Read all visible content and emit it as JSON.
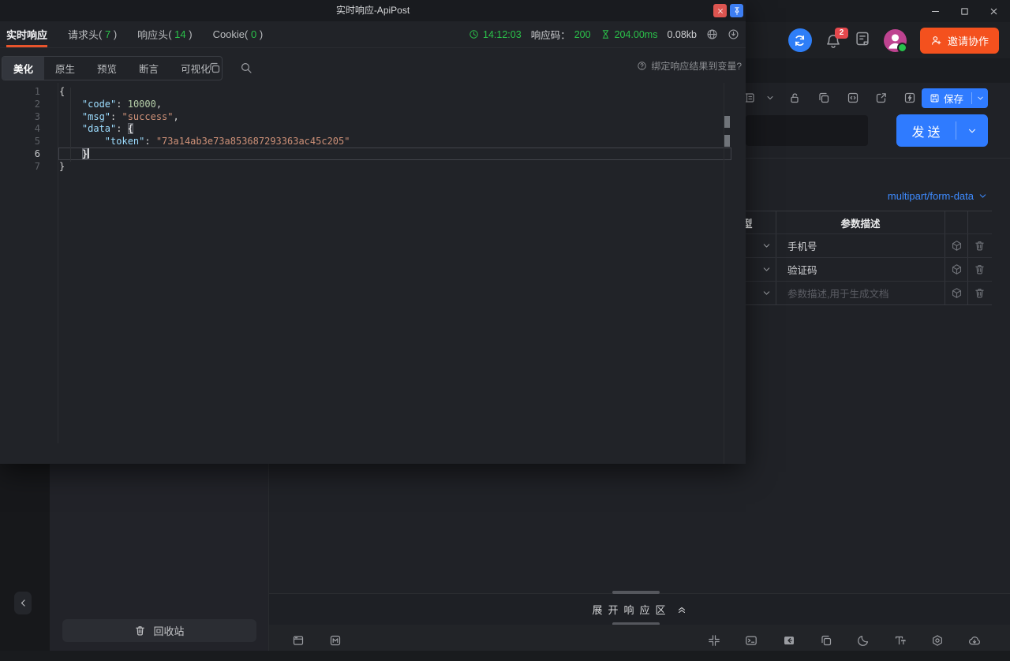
{
  "float_window": {
    "title": "实时响应-ApiPost",
    "close_icon": "xmark-icon",
    "pin_icon": "pin-icon",
    "tabs": [
      {
        "label": "实时响应",
        "count": null,
        "active": true
      },
      {
        "label": "请求头",
        "count": "7",
        "active": false
      },
      {
        "label": "响应头",
        "count": "14",
        "active": false
      },
      {
        "label": "Cookie",
        "count": "0",
        "active": false
      }
    ],
    "status": {
      "time": "14:12:03",
      "code_label": "响应码：",
      "code": "200",
      "duration": "204.00ms",
      "size": "0.08kb",
      "icons": [
        "globe-icon",
        "download-icon"
      ]
    },
    "view_tabs": [
      {
        "label": "美化",
        "active": true
      },
      {
        "label": "原生",
        "active": false
      },
      {
        "label": "预览",
        "active": false
      },
      {
        "label": "断言",
        "active": false
      },
      {
        "label": "可视化",
        "active": false
      }
    ],
    "bind_hint": "绑定响应结果到变量?",
    "editor": {
      "lines": [
        {
          "num": "1",
          "active": false,
          "tokens": [
            [
              "p",
              "{"
            ]
          ]
        },
        {
          "num": "2",
          "active": false,
          "tokens": [
            [
              "p",
              "    "
            ],
            [
              "k",
              "\"code\""
            ],
            [
              "p",
              ": "
            ],
            [
              "n",
              "10000"
            ],
            [
              "p",
              ","
            ]
          ]
        },
        {
          "num": "3",
          "active": false,
          "tokens": [
            [
              "p",
              "    "
            ],
            [
              "k",
              "\"msg\""
            ],
            [
              "p",
              ": "
            ],
            [
              "s",
              "\"success\""
            ],
            [
              "p",
              ","
            ]
          ]
        },
        {
          "num": "4",
          "active": false,
          "tokens": [
            [
              "p",
              "    "
            ],
            [
              "k",
              "\"data\""
            ],
            [
              "p",
              ": "
            ],
            [
              "bm",
              "{"
            ]
          ]
        },
        {
          "num": "5",
          "active": false,
          "tokens": [
            [
              "p",
              "        "
            ],
            [
              "k",
              "\"token\""
            ],
            [
              "p",
              ": "
            ],
            [
              "s",
              "\"73a14ab3e73a853687293363ac45c205\""
            ]
          ]
        },
        {
          "num": "6",
          "active": true,
          "tokens": [
            [
              "p",
              "    "
            ],
            [
              "bm",
              "}"
            ],
            [
              "cursor",
              ""
            ]
          ]
        },
        {
          "num": "7",
          "active": false,
          "tokens": [
            [
              "p",
              "}"
            ]
          ]
        }
      ]
    }
  },
  "app": {
    "window_controls": [
      "minimize-icon",
      "maximize-icon",
      "xmark-icon"
    ],
    "header": {
      "sync_icon": "sync-icon",
      "bell_icon": "bell-icon",
      "notification_count": "2",
      "note_icon": "note-icon",
      "avatar_icon": "user-icon",
      "invite_label": "邀请协作",
      "invite_icon": "user-plus-icon"
    },
    "request_toolbar": {
      "icons": [
        "panel-icon",
        "chevron-down-icon",
        "unlock-icon",
        "copy-icon",
        "code-square-icon",
        "share-icon",
        "bolt-icon"
      ],
      "save_label": "保存"
    },
    "send_label": "发送",
    "body_type": "multipart/form-data",
    "params_table": {
      "header": {
        "type_partial": "型",
        "desc": "参数描述"
      },
      "rows": [
        {
          "desc": "手机号",
          "muted": false
        },
        {
          "desc": "验证码",
          "muted": false
        },
        {
          "desc": "参数描述,用于生成文档",
          "muted": true
        }
      ],
      "row_icons": [
        "cube-icon",
        "trash-icon"
      ]
    },
    "recycle_label": "回收站",
    "expand_label": "展开响应区",
    "bottom_toolbar": {
      "left_icons": [
        "browser-icon",
        "markdown-icon"
      ],
      "right_icons": [
        "collapse-icon",
        "terminal-icon",
        "box-arrow-icon",
        "copy-icon",
        "moon-icon",
        "text-size-icon",
        "settings-icon",
        "cloud-download-icon"
      ]
    }
  }
}
